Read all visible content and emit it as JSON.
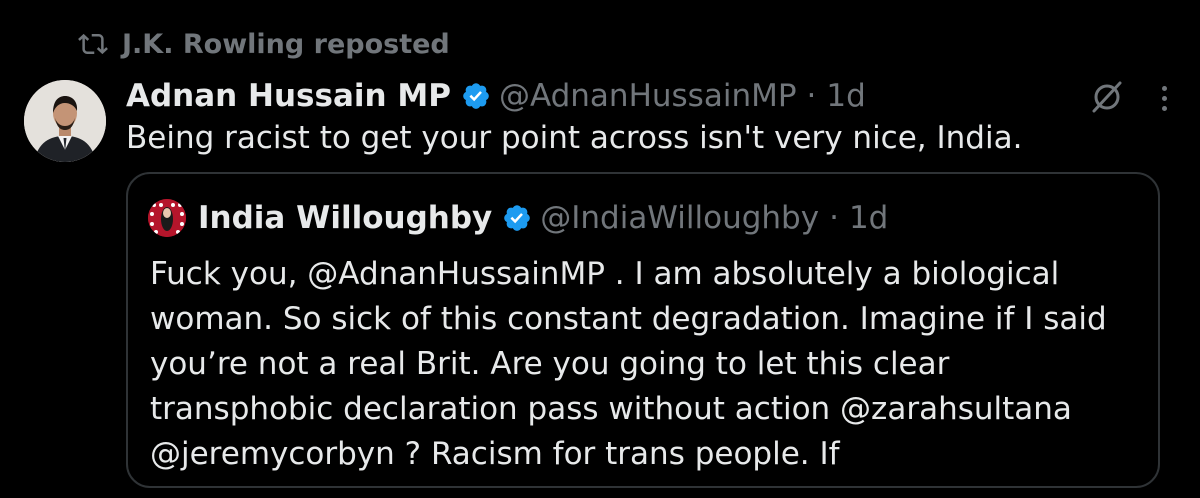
{
  "repost": {
    "text": "J.K. Rowling reposted",
    "icon": "repost-icon"
  },
  "tweet": {
    "author_name": "Adnan Hussain MP",
    "handle": "@AdnanHussainMP",
    "separator": "·",
    "time": "1d",
    "text": "Being racist to get your point across isn't very nice, India."
  },
  "quote": {
    "author_name": "India Willoughby",
    "handle": "@IndiaWilloughby",
    "separator": "·",
    "time": "1d",
    "lines": [
      "Fuck you, @AdnanHussainMP . I am absolutely a biological",
      "woman. So sick of this constant degradation. Imagine if I said",
      "you’re not a real Brit. Are you going to let this clear",
      "transphobic declaration pass without action @zarahsultana",
      "@jeremycorbyn ? Racism for trans people. If"
    ]
  },
  "colors": {
    "background": "#000000",
    "text": "#e7e9ea",
    "muted": "#71767b",
    "verified": "#1d9bf0",
    "border": "#2f3336"
  }
}
